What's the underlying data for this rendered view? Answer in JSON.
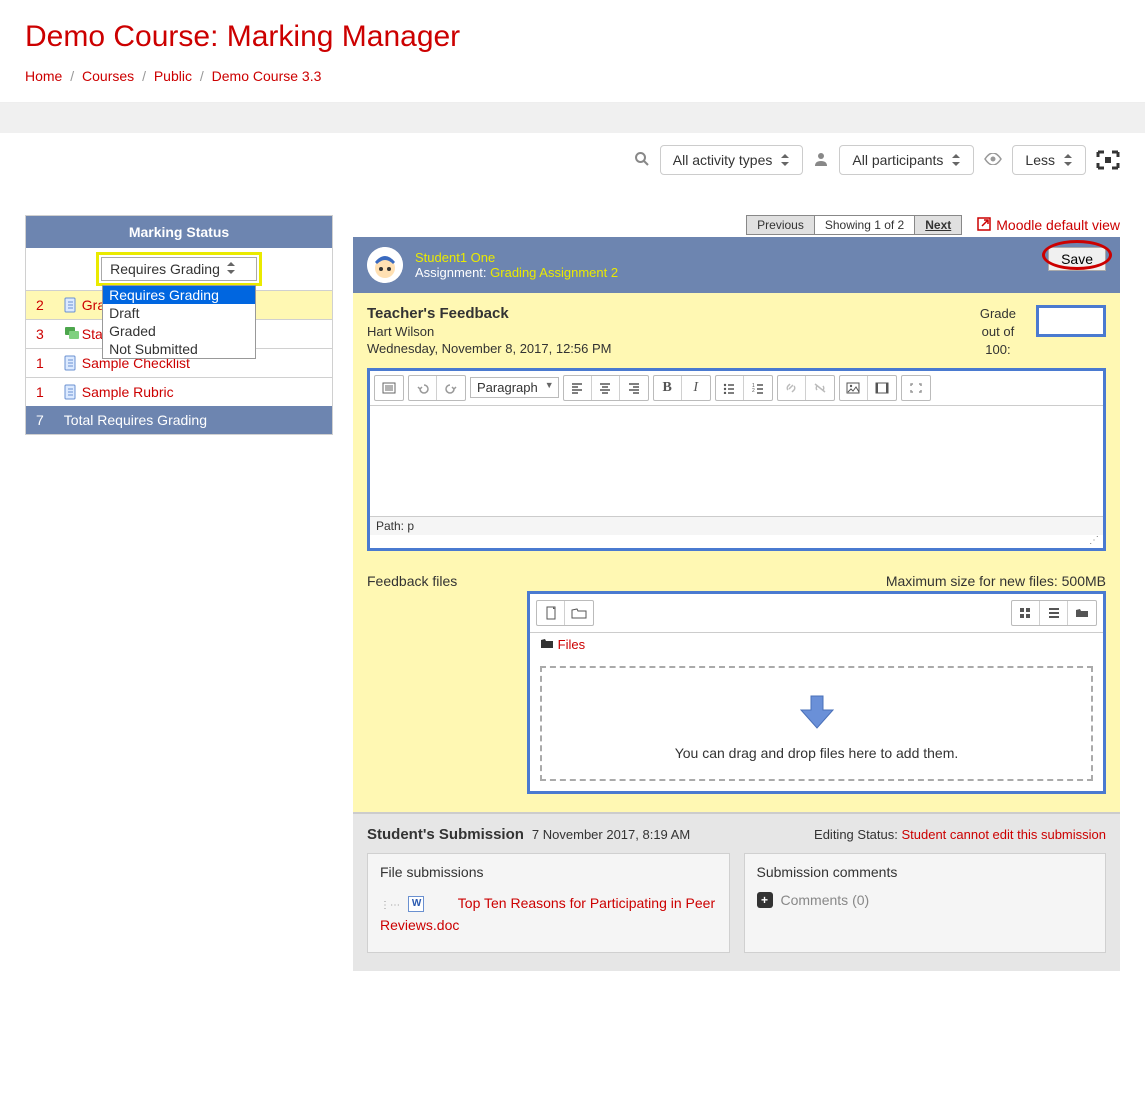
{
  "page_title": "Demo Course: Marking Manager",
  "breadcrumb": [
    "Home",
    "Courses",
    "Public",
    "Demo Course 3.3"
  ],
  "toolbar": {
    "activity_types": "All activity types",
    "participants": "All participants",
    "view": "Less"
  },
  "marking_status": {
    "header": "Marking Status",
    "filter_selected": "Requires Grading",
    "filter_options": [
      "Requires Grading",
      "Draft",
      "Graded",
      "Not Submitted"
    ],
    "rows": [
      {
        "count": "2",
        "label": "Gra",
        "hl": true
      },
      {
        "count": "3",
        "label": "Sta",
        "hl": false,
        "forum": true
      },
      {
        "count": "1",
        "label": "Sample Checklist",
        "hl": false
      },
      {
        "count": "1",
        "label": "Sample Rubric",
        "hl": false
      }
    ],
    "footer_count": "7",
    "footer_label": "Total Requires Grading"
  },
  "pager": {
    "prev": "Previous",
    "mid": "Showing 1 of 2",
    "next": "Next"
  },
  "default_view_link": "Moodle default view",
  "grading": {
    "student_name": "Student1 One",
    "assignment_prefix": "Assignment: ",
    "assignment_link": "Grading Assignment 2",
    "save_label": "Save",
    "feedback_title": "Teacher's Feedback",
    "feedback_author": "Hart Wilson",
    "feedback_date": "Wednesday, November 8, 2017, 12:56 PM",
    "grade_label_1": "Grade",
    "grade_label_2": "out of",
    "grade_label_3": "100:",
    "paragraph_label": "Paragraph",
    "path_label": "Path: p",
    "feedback_files_label": "Feedback files",
    "max_size_label": "Maximum size for new files: 500MB",
    "files_crumb": "Files",
    "drop_hint": "You can drag and drop files here to add them."
  },
  "submission": {
    "title": "Student's Submission",
    "date": "7 November 2017, 8:19 AM",
    "edit_status_label": "Editing Status:",
    "edit_status_value": "Student cannot edit this submission",
    "file_card_title": "File submissions",
    "file_name": "Top Ten Reasons for Participating in Peer Reviews.doc",
    "comments_card_title": "Submission comments",
    "comments_link": "Comments (0)"
  }
}
